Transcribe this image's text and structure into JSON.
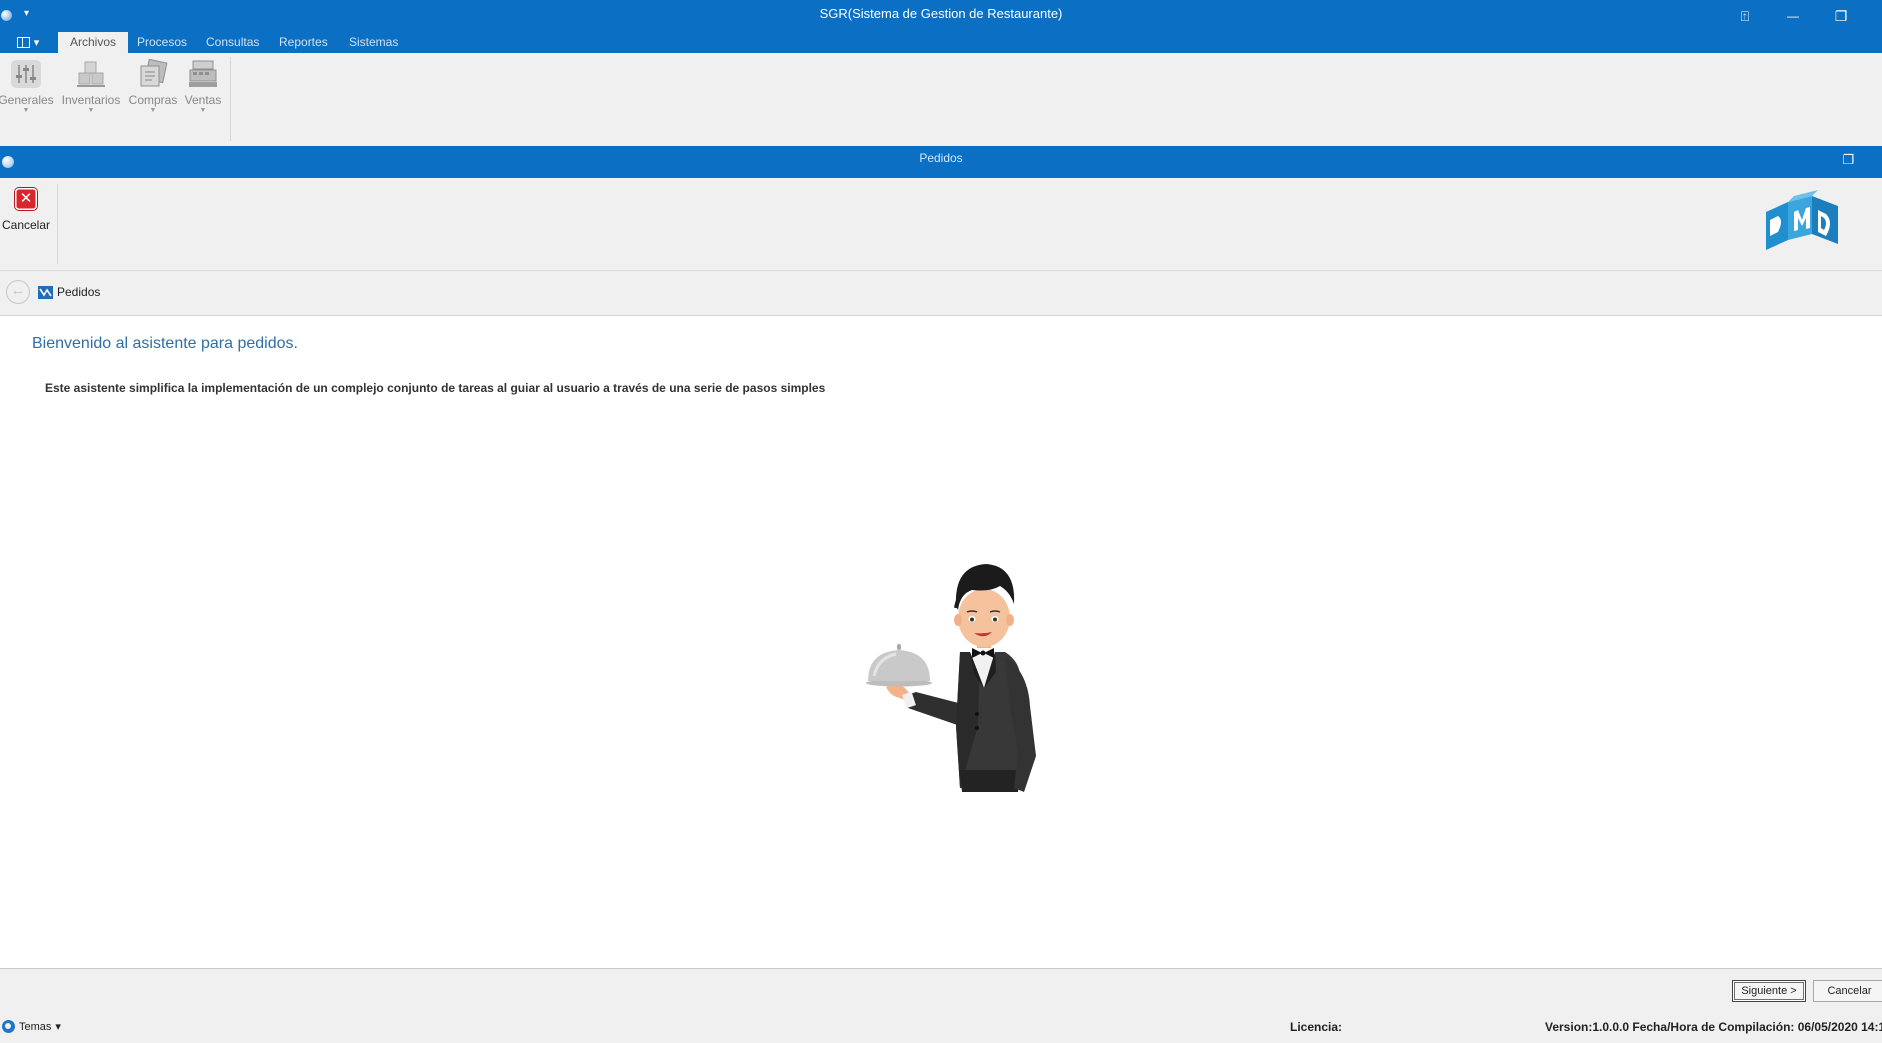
{
  "window": {
    "title": "SGR(Sistema de Gestion de Restaurante)",
    "quick_access_glyph": "▾",
    "controls": {
      "help_glyph": "⍐",
      "minimize_glyph": "—",
      "restore_glyph": "❐"
    }
  },
  "ribbon": {
    "app_menu_glyph": "▾",
    "tabs": [
      "Archivos",
      "Procesos",
      "Consultas",
      "Reportes",
      "Sistemas"
    ],
    "active_tab": "Archivos",
    "buttons": [
      {
        "label": "Generales",
        "icon": "sliders-icon"
      },
      {
        "label": "Inventarios",
        "icon": "boxes-icon"
      },
      {
        "label": "Compras",
        "icon": "purchase-documents-icon"
      },
      {
        "label": "Ventas",
        "icon": "cash-register-icon"
      }
    ],
    "dropdown_glyph": "▼"
  },
  "document": {
    "title": "Pedidos",
    "restore_glyph": "❐",
    "toolbar": {
      "cancel_label": "Cancelar",
      "cancel_glyph": "✕"
    }
  },
  "breadcrumb": {
    "back_glyph": "←",
    "current": "Pedidos"
  },
  "wizard": {
    "welcome_title": "Bienvenido al asistente para pedidos.",
    "description": "Este asistente simplifica la implementación de un complejo conjunto de tareas al guiar al usuario a través de una serie de pasos simples"
  },
  "footer": {
    "next_label": "Siguiente >",
    "cancel_label": "Cancelar",
    "themes_label": "Temas",
    "themes_arrow": "▾",
    "license_label": "Licencia:",
    "version_text": "Version:1.0.0.0 Fecha/Hora de Compilación: 06/05/2020 14:1"
  },
  "colors": {
    "title_bar": "#0b6fc4",
    "ribbon_bg": "#f0f0f0",
    "welcome_text": "#2f6fa5",
    "cancel_icon": "#d9262c"
  }
}
